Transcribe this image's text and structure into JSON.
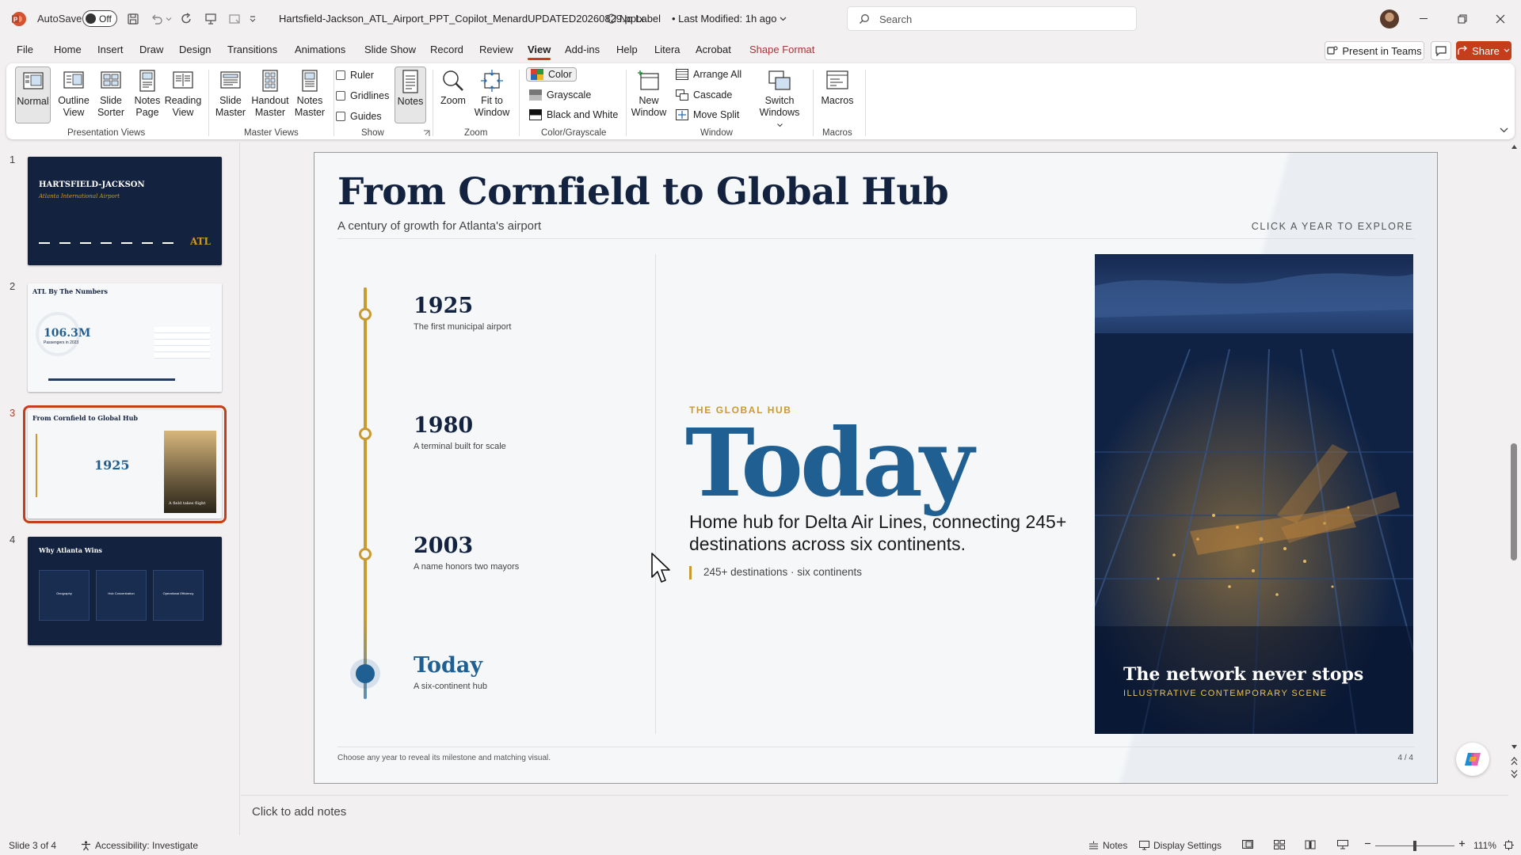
{
  "titlebar": {
    "autosave_label": "AutoSave",
    "autosave_state": "Off",
    "filename": "Hartsfield-Jackson_ATL_Airport_PPT_Copilot_MenardUPDATED20260829.pptx",
    "sensitivity": "No Label",
    "modified": "Last Modified: 1h ago",
    "search_placeholder": "Search"
  },
  "menu": {
    "tabs": [
      "File",
      "Home",
      "Insert",
      "Draw",
      "Design",
      "Transitions",
      "Animations",
      "Slide Show",
      "Record",
      "Review",
      "View",
      "Add-ins",
      "Help",
      "Litera",
      "Acrobat",
      "Shape Format"
    ],
    "active_tab": "View",
    "present_in_teams": "Present in Teams",
    "share": "Share"
  },
  "ribbon": {
    "presentation_views": {
      "label": "Presentation Views",
      "normal": "Normal",
      "outline": [
        "Outline",
        "View"
      ],
      "sorter": [
        "Slide",
        "Sorter"
      ],
      "notes_page": [
        "Notes",
        "Page"
      ],
      "reading": [
        "Reading",
        "View"
      ]
    },
    "master_views": {
      "label": "Master Views",
      "slide_master": [
        "Slide",
        "Master"
      ],
      "handout_master": [
        "Handout",
        "Master"
      ],
      "notes_master": [
        "Notes",
        "Master"
      ]
    },
    "show": {
      "label": "Show",
      "ruler": "Ruler",
      "gridlines": "Gridlines",
      "guides": "Guides",
      "notes": "Notes"
    },
    "zoom": {
      "label": "Zoom",
      "zoom": "Zoom",
      "fit": [
        "Fit to",
        "Window"
      ]
    },
    "color": {
      "label": "Color/Grayscale",
      "color": "Color",
      "grayscale": "Grayscale",
      "bw": "Black and White"
    },
    "window": {
      "label": "Window",
      "new_window": [
        "New",
        "Window"
      ],
      "arrange_all": "Arrange All",
      "cascade": "Cascade",
      "move_split": "Move Split",
      "switch": [
        "Switch",
        "Windows"
      ]
    },
    "macros": {
      "label": "Macros",
      "macros": "Macros"
    }
  },
  "thumbnails": [
    {
      "num": "1",
      "title": "HARTSFIELD-JACKSON",
      "subtitle": "Atlanta International Airport",
      "badge": "ATL"
    },
    {
      "num": "2",
      "title": "ATL By The Numbers",
      "stat": "106.3M",
      "stat_label": "Passengers in 2023"
    },
    {
      "num": "3",
      "title": "From Cornfield to Global Hub",
      "big": "1925",
      "caption": "A field takes flight"
    },
    {
      "num": "4",
      "title": "Why Atlanta Wins",
      "cols": [
        "Geography",
        "Hub Concentration",
        "Operational Efficiency"
      ]
    }
  ],
  "slide": {
    "title": "From Cornfield to Global Hub",
    "subtitle": "A century of growth for Atlanta's airport",
    "cta": "CLICK A YEAR TO EXPLORE",
    "timeline": [
      {
        "year": "1925",
        "desc": "The first municipal airport"
      },
      {
        "year": "1980",
        "desc": "A terminal built for scale"
      },
      {
        "year": "2003",
        "desc": "A name honors two mayors"
      },
      {
        "year": "Today",
        "desc": "A six-continent hub"
      }
    ],
    "detail": {
      "eyebrow": "THE GLOBAL HUB",
      "big": "Today",
      "body": "Home hub for Delta Air Lines, connecting 245+ destinations across six continents.",
      "meta": "245+ destinations · six continents"
    },
    "photo_caption": "The network never stops",
    "photo_sub": "ILLUSTRATIVE CONTEMPORARY SCENE",
    "footer": "Choose any year to reveal its milestone and matching visual.",
    "page": "4 / 4"
  },
  "notes_placeholder": "Click to add notes",
  "status": {
    "slide": "Slide 3 of 4",
    "accessibility": "Accessibility: Investigate",
    "notes": "Notes",
    "display": "Display Settings",
    "zoom": "111%"
  },
  "colors": {
    "accent": "#c43e1c",
    "navy": "#13233f",
    "blue": "#1f5f92",
    "gold": "#c99a2e"
  }
}
